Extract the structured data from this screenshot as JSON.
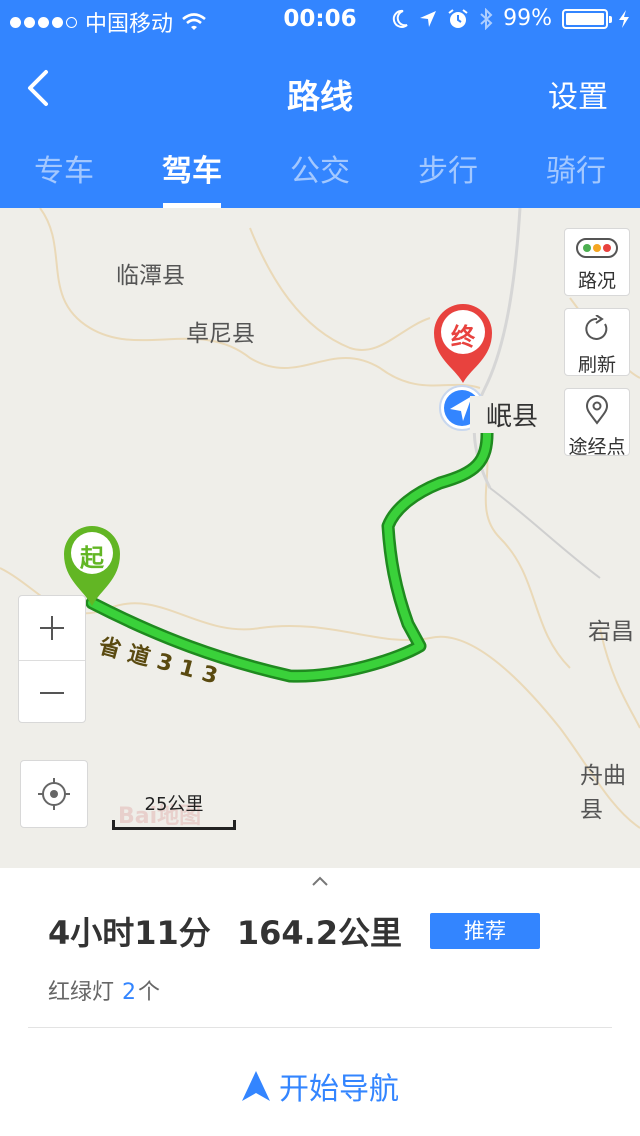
{
  "status_bar": {
    "carrier": "中国移动",
    "time": "00:06",
    "battery": "99%",
    "battery_level": 0.99
  },
  "nav": {
    "title": "路线",
    "settings_label": "设置"
  },
  "tabs": [
    {
      "label": "专车",
      "active": false
    },
    {
      "label": "驾车",
      "active": true
    },
    {
      "label": "公交",
      "active": false
    },
    {
      "label": "步行",
      "active": false
    },
    {
      "label": "骑行",
      "active": false
    }
  ],
  "map": {
    "places": [
      "临潭县",
      "卓尼县",
      "岷县",
      "宕昌",
      "舟曲县"
    ],
    "road_label": "省道313",
    "start_marker": "起",
    "end_marker": "终",
    "scale_label": "25公里",
    "watermark": "Bai地图",
    "controls": {
      "traffic_label": "路况",
      "refresh_label": "刷新",
      "waypoint_label": "途经点"
    },
    "colors": {
      "route": "#2fbf2f",
      "start": "#62b624",
      "end": "#e8423e"
    }
  },
  "route": {
    "duration": "4小时11分",
    "distance": "164.2公里",
    "tag": "推荐",
    "traffic_lights_label": "红绿灯",
    "traffic_lights_count": "2",
    "traffic_lights_unit": "个"
  },
  "action": {
    "start_navigation": "开始导航"
  },
  "colors": {
    "primary": "#3385ff"
  }
}
